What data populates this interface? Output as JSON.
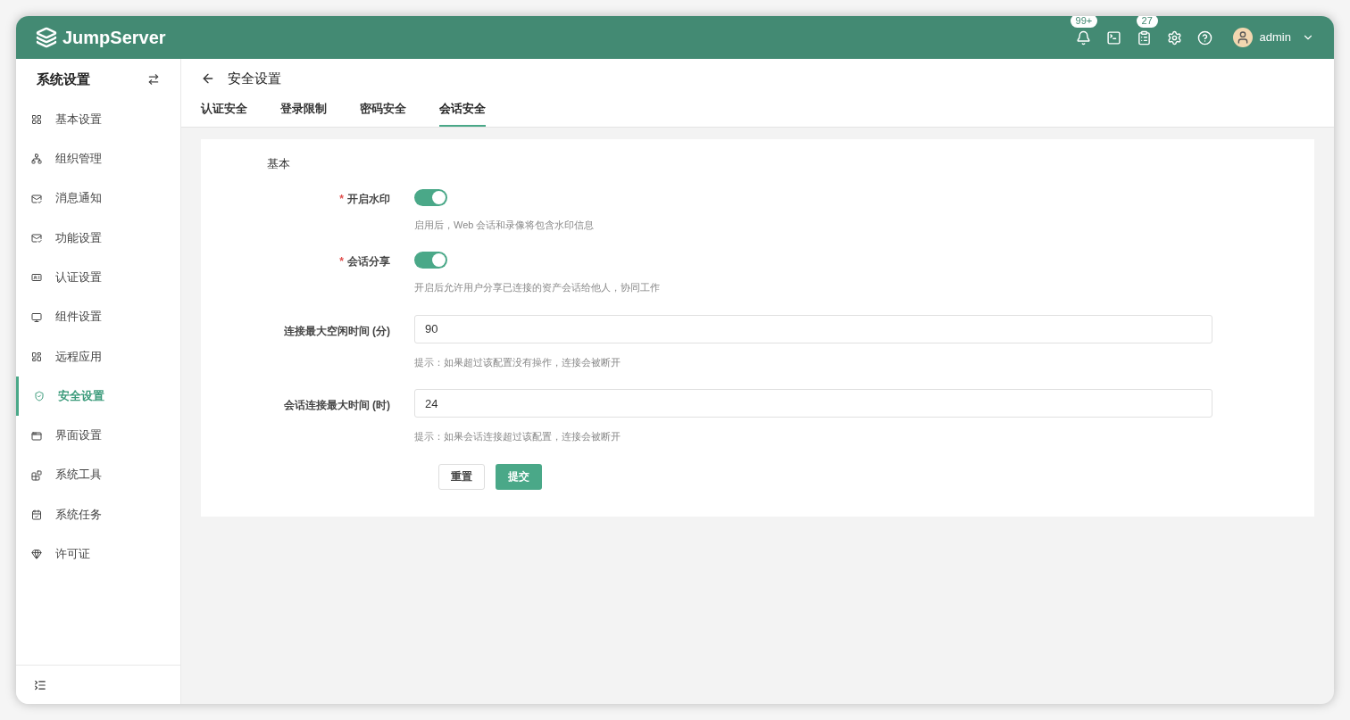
{
  "header": {
    "brand": "JumpServer",
    "notifications_badge": "99+",
    "tasks_badge": "27",
    "user": "admin"
  },
  "sidebar": {
    "title": "系统设置",
    "items": [
      {
        "label": "基本设置",
        "selected": false
      },
      {
        "label": "组织管理",
        "selected": false
      },
      {
        "label": "消息通知",
        "selected": false
      },
      {
        "label": "功能设置",
        "selected": false
      },
      {
        "label": "认证设置",
        "selected": false
      },
      {
        "label": "组件设置",
        "selected": false
      },
      {
        "label": "远程应用",
        "selected": false
      },
      {
        "label": "安全设置",
        "selected": true
      },
      {
        "label": "界面设置",
        "selected": false
      },
      {
        "label": "系统工具",
        "selected": false
      },
      {
        "label": "系统任务",
        "selected": false
      },
      {
        "label": "许可证",
        "selected": false
      }
    ]
  },
  "page": {
    "title": "安全设置",
    "tabs": [
      {
        "label": "认证安全",
        "selected": false
      },
      {
        "label": "登录限制",
        "selected": false
      },
      {
        "label": "密码安全",
        "selected": false
      },
      {
        "label": "会话安全",
        "selected": true
      }
    ]
  },
  "form": {
    "section": "基本",
    "fields": [
      {
        "kind": "switch",
        "required_mark": "*",
        "label": "开启水印",
        "on": true,
        "help": "启用后，Web 会话和录像将包含水印信息"
      },
      {
        "kind": "switch",
        "required_mark": "*",
        "label": "会话分享",
        "on": true,
        "help": "开启后允许用户分享已连接的资产会话给他人，协同工作"
      },
      {
        "kind": "input",
        "label": "连接最大空闲时间 (分)",
        "value": "90",
        "help": "提示：如果超过该配置没有操作，连接会被断开"
      },
      {
        "kind": "input",
        "label": "会话连接最大时间 (时)",
        "value": "24",
        "help": "提示：如果会话连接超过该配置，连接会被断开"
      }
    ],
    "reset": "重置",
    "submit": "提交"
  }
}
